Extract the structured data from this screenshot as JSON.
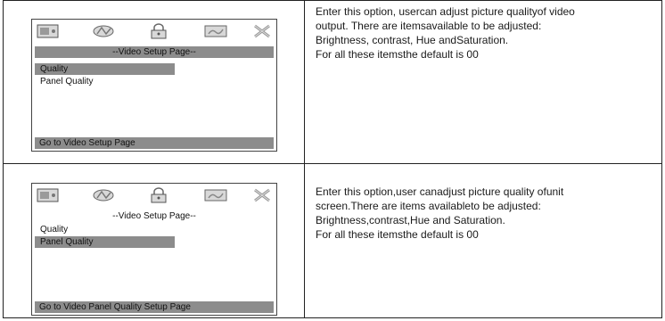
{
  "rows": [
    {
      "osd": {
        "title": "--Video Setup Page--",
        "items": [
          "Quality",
          "Panel Quality"
        ],
        "footer": "Go to Video Setup Page"
      },
      "description": [
        "Enter  this option, usercan adjust picture qualityof video",
        "output. There are itemsavailable to be adjusted:",
        "Brightness, contrast, Hue andSaturation.",
        "For all these itemsthe default is 00"
      ]
    },
    {
      "osd": {
        "title": "--Video Setup Page--",
        "items": [
          "Quality",
          "Panel Quality"
        ],
        "footer": "Go to Video Panel Quality Setup Page"
      },
      "description": [
        "Enter this option,user canadjust picture quality ofunit",
        "screen.There are  items availableto be adjusted:",
        "Brightness,contrast,Hue and Saturation.",
        "For all these itemsthe default is 00"
      ]
    }
  ],
  "icons": [
    "general-setup-icon",
    "audio-setup-icon",
    "password-lock-icon",
    "video-setup-icon",
    "exit-icon"
  ]
}
